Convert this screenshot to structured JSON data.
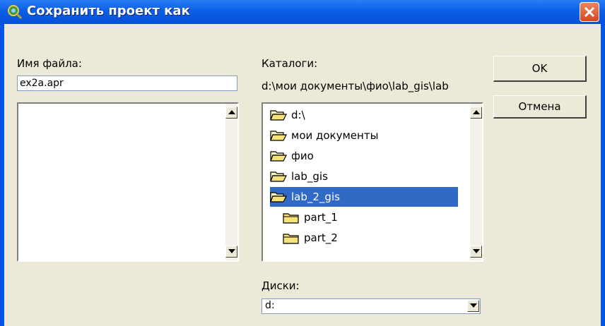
{
  "window": {
    "title": "Сохранить проект как"
  },
  "filename": {
    "label": "Имя файла:",
    "value": "ex2a.apr"
  },
  "directories": {
    "label": "Каталоги:",
    "current_path": "d:\\мои документы\\фио\\lab_gis\\lab",
    "items": [
      {
        "label": "d:\\",
        "icon": "open-folder-icon",
        "selected": false
      },
      {
        "label": "мои документы",
        "icon": "open-folder-icon",
        "selected": false
      },
      {
        "label": "фио",
        "icon": "open-folder-icon",
        "selected": false
      },
      {
        "label": "lab_gis",
        "icon": "open-folder-icon",
        "selected": false
      },
      {
        "label": "lab_2_gis",
        "icon": "open-folder-icon",
        "selected": true
      },
      {
        "label": "part_1",
        "icon": "closed-folder-icon",
        "selected": false
      },
      {
        "label": "part_2",
        "icon": "closed-folder-icon",
        "selected": false
      }
    ]
  },
  "drives": {
    "label": "Диски:",
    "value": "d:"
  },
  "buttons": {
    "ok": "OK",
    "cancel": "Отмена"
  },
  "colors": {
    "selection": "#316ac5",
    "titlebar": "#0a5fe6",
    "face": "#ece9d8"
  }
}
